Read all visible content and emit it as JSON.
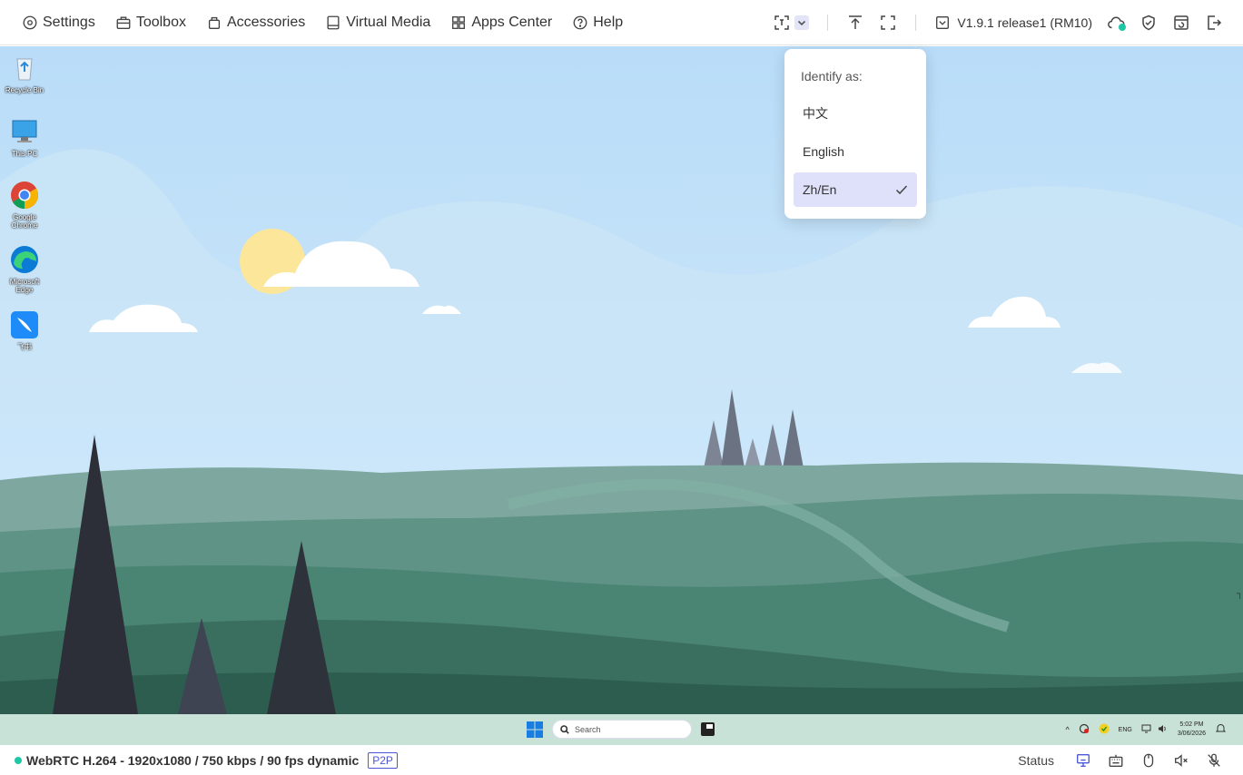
{
  "menu": {
    "items": [
      {
        "label": "Settings",
        "icon": "settings-icon"
      },
      {
        "label": "Toolbox",
        "icon": "toolbox-icon"
      },
      {
        "label": "Accessories",
        "icon": "accessories-icon"
      },
      {
        "label": "Virtual Media",
        "icon": "virtual-media-icon"
      },
      {
        "label": "Apps Center",
        "icon": "apps-center-icon"
      },
      {
        "label": "Help",
        "icon": "help-icon"
      }
    ]
  },
  "toolbar": {
    "version": "V1.9.1 release1 (RM10)",
    "cloud_status_color": "#1fc7a4"
  },
  "popup": {
    "title": "Identify as:",
    "options": [
      {
        "label": "中文",
        "selected": false
      },
      {
        "label": "English",
        "selected": false
      },
      {
        "label": "Zh/En",
        "selected": true
      }
    ]
  },
  "desktop": {
    "icons": [
      {
        "label": "Recycle Bin"
      },
      {
        "label": "This PC"
      },
      {
        "label": "Google Chrome"
      },
      {
        "label": "Microsoft Edge"
      },
      {
        "label": "飞书"
      }
    ],
    "taskbar": {
      "search_placeholder": "Search",
      "lang": "ENG",
      "time": "5:02 PM",
      "date": "3/06/2026"
    }
  },
  "statusbar": {
    "stream_info": "WebRTC H.264 - 1920x1080 /  750 kbps / 90 fps dynamic",
    "connection": "P2P",
    "status_label": "Status",
    "accent": "#4a57d6"
  }
}
